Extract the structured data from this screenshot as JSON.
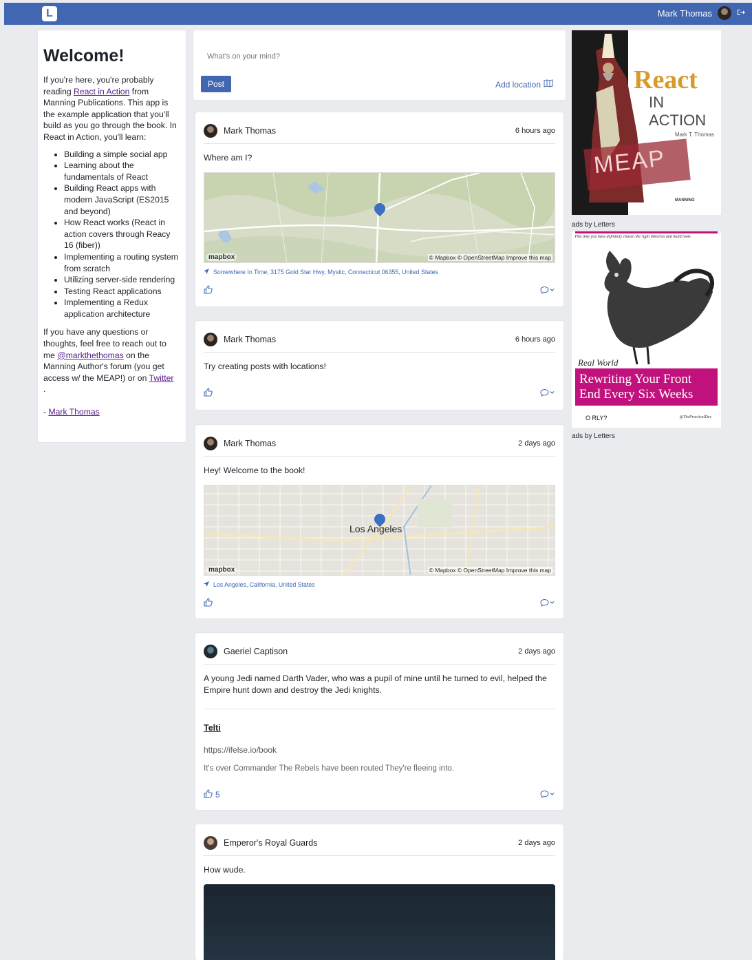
{
  "nav": {
    "user_name": "Mark Thomas",
    "logo_letter": "L"
  },
  "welcome": {
    "title": "Welcome!",
    "intro_1": "If you're here, you're probably reading ",
    "book_link": "React in Action",
    "intro_2": " from Manning Publications. This app is the example application that you'll build as you go through the book. In React in Action, you'll learn:",
    "bullets": [
      "Building a simple social app",
      "Learning about the fundamentals of React",
      "Building React apps with modern JavaScript (ES2015 and beyond)",
      "How React works (React in action covers through Reacy 16 (fiber))",
      "Implementing a routing system from scratch",
      "Utilizing server-side rendering",
      "Testing React applications",
      "Implementing a Redux application architecture"
    ],
    "outro_1": "If you have any questions or thoughts, feel free to reach out to me ",
    "handle_link": "@markthethomas",
    "outro_2": " on the Manning Author's forum (you get access w/ the MEAP!) or on ",
    "twitter_link": "Twitter",
    "outro_3": ".",
    "sign_dash": "- ",
    "sign_link": "Mark Thomas"
  },
  "composer": {
    "placeholder": "What's on your mind?",
    "post_label": "Post",
    "add_location_label": "Add location"
  },
  "posts": [
    {
      "author": "Mark Thomas",
      "time": "6 hours ago",
      "text": "Where am I?",
      "location": "Somewhere In Time, 3175 Gold Star Hwy, Mystic, Connecticut 06355, United States"
    },
    {
      "author": "Mark Thomas",
      "time": "6 hours ago",
      "text": "Try creating posts with locations!"
    },
    {
      "author": "Mark Thomas",
      "time": "2 days ago",
      "text": "Hey! Welcome to the book!",
      "location": "Los Angeles, California, United States",
      "map_city": "Los Angeles"
    },
    {
      "author": "Gaeriel Captison",
      "time": "2 days ago",
      "text": "A young Jedi named Darth Vader, who was a pupil of mine until he turned to evil, helped the Empire hunt down and destroy the Jedi knights.",
      "link_title": "Telti",
      "link_url": "https://ifelse.io/book",
      "link_desc": "It's over Commander The Rebels have been routed They're fleeing into.",
      "likes": "5"
    },
    {
      "author": "Emperor's Royal Guards",
      "time": "2 days ago",
      "text": "How wude."
    }
  ],
  "map": {
    "brand": "mapbox",
    "attribution": "© Mapbox © OpenStreetMap Improve this map"
  },
  "ads": {
    "label": "ads by Letters",
    "book1": {
      "title_1": "React",
      "title_2": "IN ACTION",
      "author": "Mark T. Thomas",
      "stamp": "MEAP",
      "publisher": "MANNING"
    },
    "book2": {
      "tagline": "This time you have definitely chosen the right libraries and build tools",
      "subtitle": "Real World",
      "title_1": "Rewriting Your Front",
      "title_2": "End Every Six Weeks",
      "publisher": "O RLY?",
      "author": "@ThePracticalDev"
    }
  },
  "colors": {
    "brand": "#4267b2",
    "background": "#e9ebee",
    "ad_magenta": "#c0117d"
  }
}
